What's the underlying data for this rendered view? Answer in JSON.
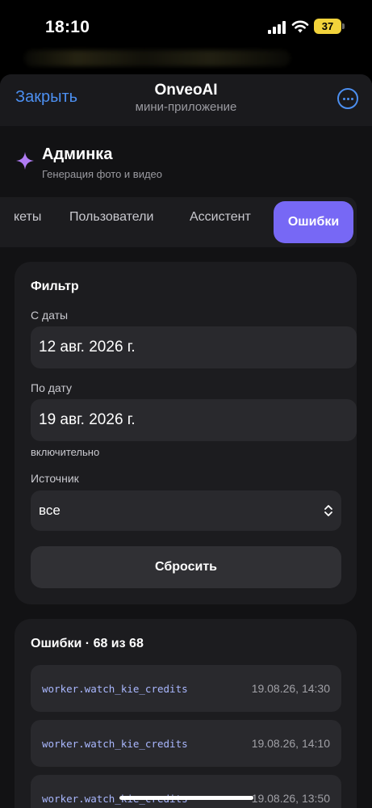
{
  "status_bar": {
    "time": "18:10",
    "battery": "37"
  },
  "nav": {
    "close_label": "Закрыть",
    "title": "OnveoAI",
    "subtitle": "мини-приложение"
  },
  "app": {
    "title": "Админка",
    "subtitle": "Генерация фото и видео"
  },
  "tabs": [
    {
      "label": "кеты"
    },
    {
      "label": "Пользователи"
    },
    {
      "label": "Ассистент"
    },
    {
      "label": "Ошибки",
      "active": true
    }
  ],
  "filter": {
    "title": "Фильтр",
    "from_label": "С даты",
    "from_value": "12 авг. 2026 г.",
    "to_label": "По дату",
    "to_value": "19 авг. 2026 г.",
    "inclusive_hint": "включительно",
    "source_label": "Источник",
    "source_value": "все",
    "reset_label": "Сбросить"
  },
  "errors": {
    "title": "Ошибки · 68 из 68",
    "rows": [
      {
        "name": "worker.watch_kie_credits",
        "time": "19.08.26, 14:30"
      },
      {
        "name": "worker.watch_kie_credits",
        "time": "19.08.26, 14:10"
      },
      {
        "name": "worker.watch_kie_credits",
        "time": "19.08.26, 13:50"
      }
    ]
  },
  "colors": {
    "accent": "#7768f5",
    "link": "#4c8ff0",
    "background": "#121214",
    "card": "#1c1c1f"
  }
}
